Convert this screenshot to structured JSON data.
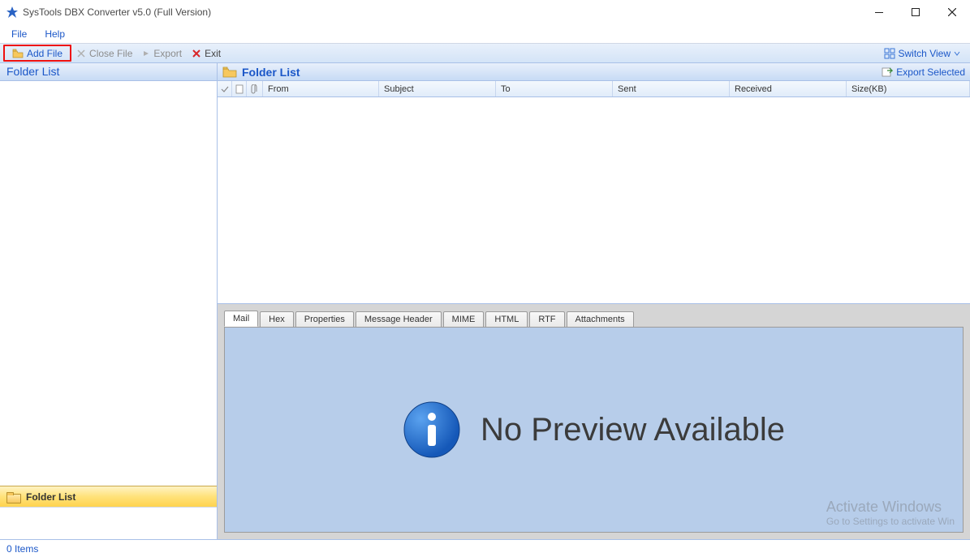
{
  "title": "SysTools DBX Converter v5.0 (Full Version)",
  "menu": {
    "file": "File",
    "help": "Help"
  },
  "toolbar": {
    "add_file": "Add File",
    "close_file": "Close File",
    "export": "Export",
    "exit": "Exit",
    "switch_view": "Switch View"
  },
  "sidebar": {
    "header": "Folder List",
    "footer_label": "Folder List"
  },
  "rightpane": {
    "header": "Folder List",
    "export_selected": "Export Selected",
    "columns": {
      "from": "From",
      "subject": "Subject",
      "to": "To",
      "sent": "Sent",
      "received": "Received",
      "size": "Size(KB)"
    }
  },
  "tabs": {
    "mail": "Mail",
    "hex": "Hex",
    "properties": "Properties",
    "message_header": "Message Header",
    "mime": "MIME",
    "html": "HTML",
    "rtf": "RTF",
    "attachments": "Attachments"
  },
  "preview": {
    "no_preview": "No Preview Available"
  },
  "watermark": {
    "line1": "Activate Windows",
    "line2": "Go to Settings to activate Win"
  },
  "status": {
    "items": "0 Items"
  }
}
